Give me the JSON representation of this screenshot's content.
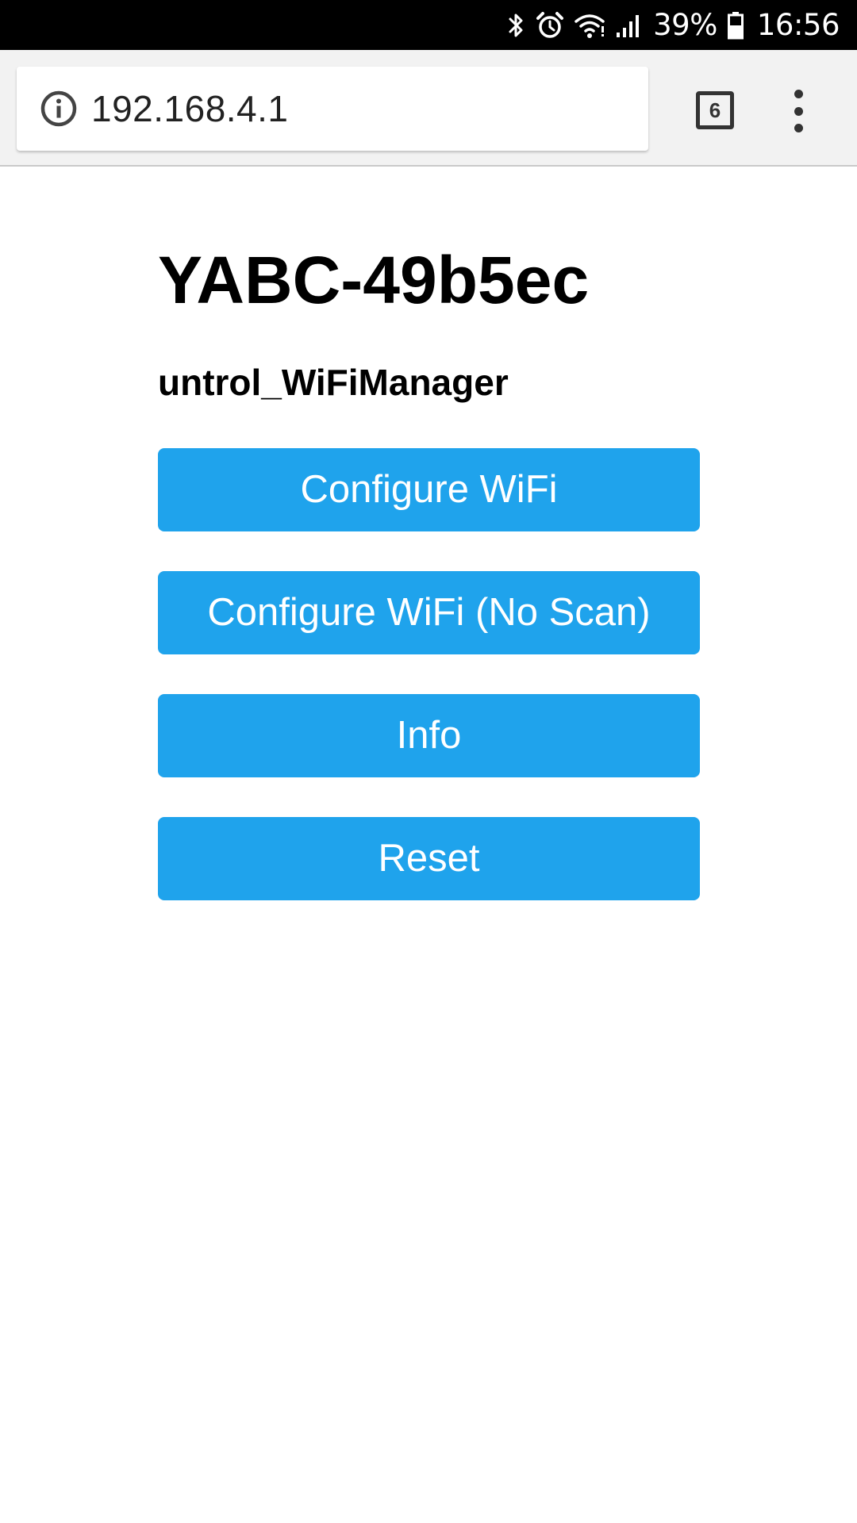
{
  "status_bar": {
    "icons": [
      "bluetooth-icon",
      "alarm-icon",
      "wifi-icon",
      "signal-icon",
      "battery-icon"
    ],
    "battery_percent": "39%",
    "time": "16:56"
  },
  "browser": {
    "url": "192.168.4.1",
    "tab_count": "6"
  },
  "page": {
    "title": "YABC-49b5ec",
    "subtitle": "untrol_WiFiManager",
    "buttons": [
      {
        "label": "Configure WiFi"
      },
      {
        "label": "Configure WiFi (No Scan)"
      },
      {
        "label": "Info"
      },
      {
        "label": "Reset"
      }
    ]
  },
  "colors": {
    "button_bg": "#1fa3ec",
    "button_text": "#ffffff",
    "status_bar_bg": "#000000",
    "toolbar_bg": "#f2f2f2"
  }
}
